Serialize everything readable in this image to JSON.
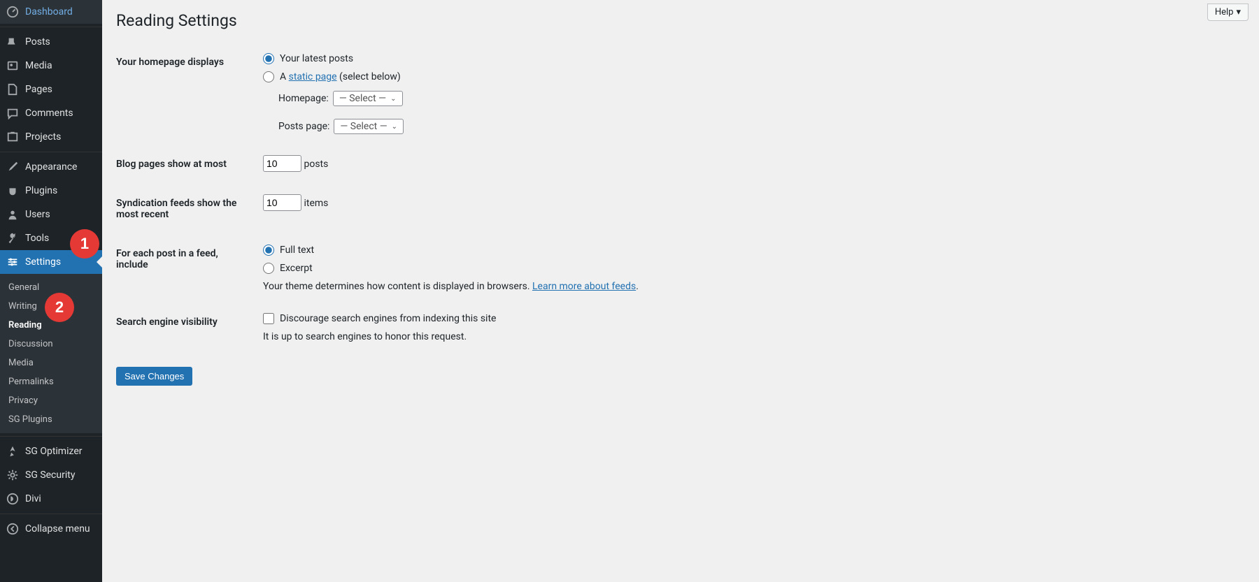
{
  "annotations": {
    "badge1": "1",
    "badge2": "2"
  },
  "help": {
    "label": "Help"
  },
  "sidebar": {
    "dashboard": "Dashboard",
    "posts": "Posts",
    "media": "Media",
    "pages": "Pages",
    "comments": "Comments",
    "projects": "Projects",
    "appearance": "Appearance",
    "plugins": "Plugins",
    "users": "Users",
    "tools": "Tools",
    "settings": "Settings",
    "sg_optimizer": "SG Optimizer",
    "sg_security": "SG Security",
    "divi": "Divi",
    "collapse": "Collapse menu",
    "settings_sub": {
      "general": "General",
      "writing": "Writing",
      "reading": "Reading",
      "discussion": "Discussion",
      "media": "Media",
      "permalinks": "Permalinks",
      "privacy": "Privacy",
      "sg_plugins": "SG Plugins"
    }
  },
  "main": {
    "title": "Reading Settings",
    "homepage": {
      "label": "Your homepage displays",
      "opt_latest": "Your latest posts",
      "opt_static_prefix": "A ",
      "opt_static_link": "static page",
      "opt_static_suffix": " (select below)",
      "homepage_label": "Homepage:",
      "posts_page_label": "Posts page:",
      "select_placeholder_1": "— Select —",
      "select_placeholder_2": "— Select —"
    },
    "blog_pages": {
      "label": "Blog pages show at most",
      "value": "10",
      "unit": "posts"
    },
    "syndication": {
      "label": "Syndication feeds show the most recent",
      "value": "10",
      "unit": "items"
    },
    "feed_include": {
      "label": "For each post in a feed, include",
      "opt_full": "Full text",
      "opt_excerpt": "Excerpt",
      "desc_pre": "Your theme determines how content is displayed in browsers. ",
      "desc_link": "Learn more about feeds",
      "desc_post": "."
    },
    "search_engine": {
      "label": "Search engine visibility",
      "checkbox": "Discourage search engines from indexing this site",
      "desc": "It is up to search engines to honor this request."
    },
    "save_button": "Save Changes"
  }
}
